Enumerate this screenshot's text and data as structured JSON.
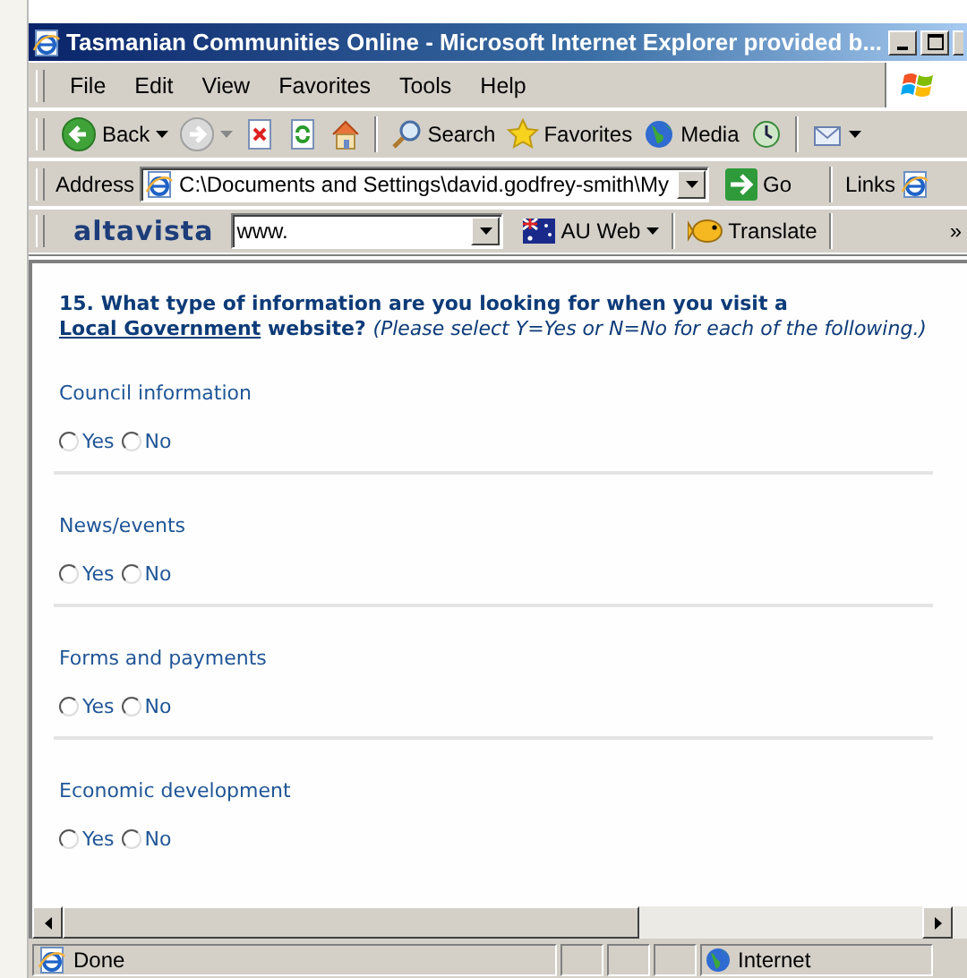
{
  "window": {
    "title": "Tasmanian Communities Online - Microsoft Internet Explorer provided b..."
  },
  "menu": [
    "File",
    "Edit",
    "View",
    "Favorites",
    "Tools",
    "Help"
  ],
  "toolbar": {
    "back": "Back",
    "search": "Search",
    "favorites": "Favorites",
    "media": "Media"
  },
  "address_bar": {
    "label": "Address",
    "value": "C:\\Documents and Settings\\david.godfrey-smith\\My",
    "go": "Go",
    "links": "Links"
  },
  "altavista": {
    "logo": "altavista",
    "value": "www.",
    "region": "AU Web",
    "translate": "Translate",
    "more": "»"
  },
  "question": {
    "number": "15.",
    "prompt_start": "What type of information are you looking for when you visit a",
    "link": "Local Government",
    "prompt_end": "website?",
    "hint": "(Please select Y=Yes or N=No for each of the following.)"
  },
  "items": [
    {
      "label": "Council information",
      "options": [
        {
          "label": "Yes",
          "selected": false
        },
        {
          "label": "No",
          "selected": false
        }
      ]
    },
    {
      "label": "News/events",
      "options": [
        {
          "label": "Yes",
          "selected": false
        },
        {
          "label": "No",
          "selected": false
        }
      ]
    },
    {
      "label": "Forms and payments",
      "options": [
        {
          "label": "Yes",
          "selected": false
        },
        {
          "label": "No",
          "selected": false
        }
      ]
    },
    {
      "label": "Economic development",
      "options": [
        {
          "label": "Yes",
          "selected": false
        },
        {
          "label": "No",
          "selected": false
        }
      ]
    }
  ],
  "status_bar": {
    "text": "Done",
    "zone": "Internet"
  }
}
